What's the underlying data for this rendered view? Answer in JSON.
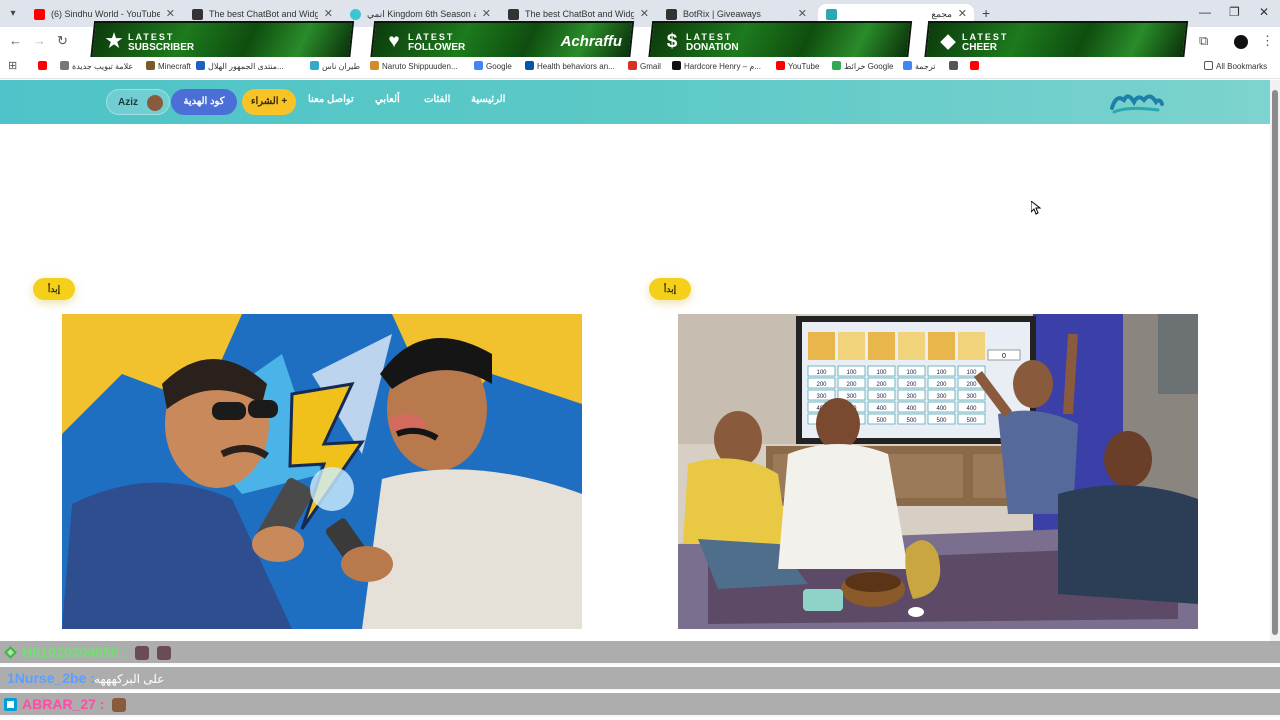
{
  "browser": {
    "tabs": [
      {
        "title": "(6) Sindhu World - YouTube",
        "favicon_color": "#ff0000"
      },
      {
        "title": "The best ChatBot and Widgets",
        "favicon_color": "#333333"
      },
      {
        "title": "انمي Kingdom 6th Season الحلقة",
        "favicon_color": "#3ec5d1"
      },
      {
        "title": "The best ChatBot and Widgets",
        "favicon_color": "#333333"
      },
      {
        "title": "BotRix | Giveaways",
        "favicon_color": "#333333"
      },
      {
        "title": "مجمع",
        "favicon_color": "#2aa7b0"
      }
    ],
    "bookmarks": [
      {
        "label": "",
        "color": "#ff0000"
      },
      {
        "label": "علامة تبويب جديدة",
        "color": "#777777"
      },
      {
        "label": "Minecraft",
        "color": "#7a5a2a"
      },
      {
        "label": "منتدى الجمهور الهلال...",
        "color": "#1f5fbf"
      },
      {
        "label": "طيران ناس",
        "color": "#33aacc"
      },
      {
        "label": "Naruto Shippuuden...",
        "color": "#d38b2b"
      },
      {
        "label": "Google",
        "color": "#4285f4"
      },
      {
        "label": "Health behaviors an...",
        "color": "#0055aa"
      },
      {
        "label": "Gmail",
        "color": "#d93025"
      },
      {
        "label": "Hardcore Henry – م...",
        "color": "#111111"
      },
      {
        "label": "YouTube",
        "color": "#ff0000"
      },
      {
        "label": "خرائط Google",
        "color": "#34a853"
      },
      {
        "label": "ترجمة",
        "color": "#4285f4"
      },
      {
        "label": "",
        "color": "#555555"
      },
      {
        "label": "",
        "color": "#ff0000"
      }
    ],
    "all_bookmarks_label": "All Bookmarks"
  },
  "overlay": {
    "banners": [
      {
        "line1": "LATEST",
        "line2": "SUBSCRIBER",
        "value": "",
        "icon": "star-icon"
      },
      {
        "line1": "LATEST",
        "line2": "FOLLOWER",
        "value": "Achraffu",
        "icon": "heart-icon"
      },
      {
        "line1": "LATEST",
        "line2": "DONATION",
        "value": "",
        "icon": "dollar-icon"
      },
      {
        "line1": "LATEST",
        "line2": "CHEER",
        "value": "",
        "icon": "diamond-icon"
      }
    ]
  },
  "site": {
    "user_name": "Aziz",
    "gift_code_label": "كود الهدية",
    "buy_label": "الشراء +",
    "nav": [
      "تواصل معنا",
      "ألعابي",
      "الفئات",
      "الرئيسية"
    ],
    "accent": "#4fc3c9"
  },
  "content": {
    "cards": [
      {
        "start_label": "إبدأ",
        "image": "vs-illustration"
      },
      {
        "start_label": "إبدأ",
        "image": "game-night-illustration"
      }
    ],
    "tv_board_values": [
      "100",
      "100",
      "100",
      "100",
      "100",
      "100",
      "200",
      "200",
      "200",
      "200",
      "200",
      "200",
      "300",
      "300",
      "300",
      "300",
      "300",
      "300",
      "400",
      "400",
      "400",
      "400",
      "400",
      "400",
      "500",
      "500",
      "500",
      "500",
      "500",
      "500"
    ],
    "tv_score": "0"
  },
  "chat": {
    "messages": [
      {
        "user": "Hh1020304050",
        "user_color": "#6fe06f",
        "text": ""
      },
      {
        "user": "1Nurse_2be",
        "user_color": "#5aa0ff",
        "text": "على البركهههه"
      },
      {
        "user": "ABRAR_27",
        "user_color": "#ff4da6",
        "text": ""
      }
    ]
  }
}
